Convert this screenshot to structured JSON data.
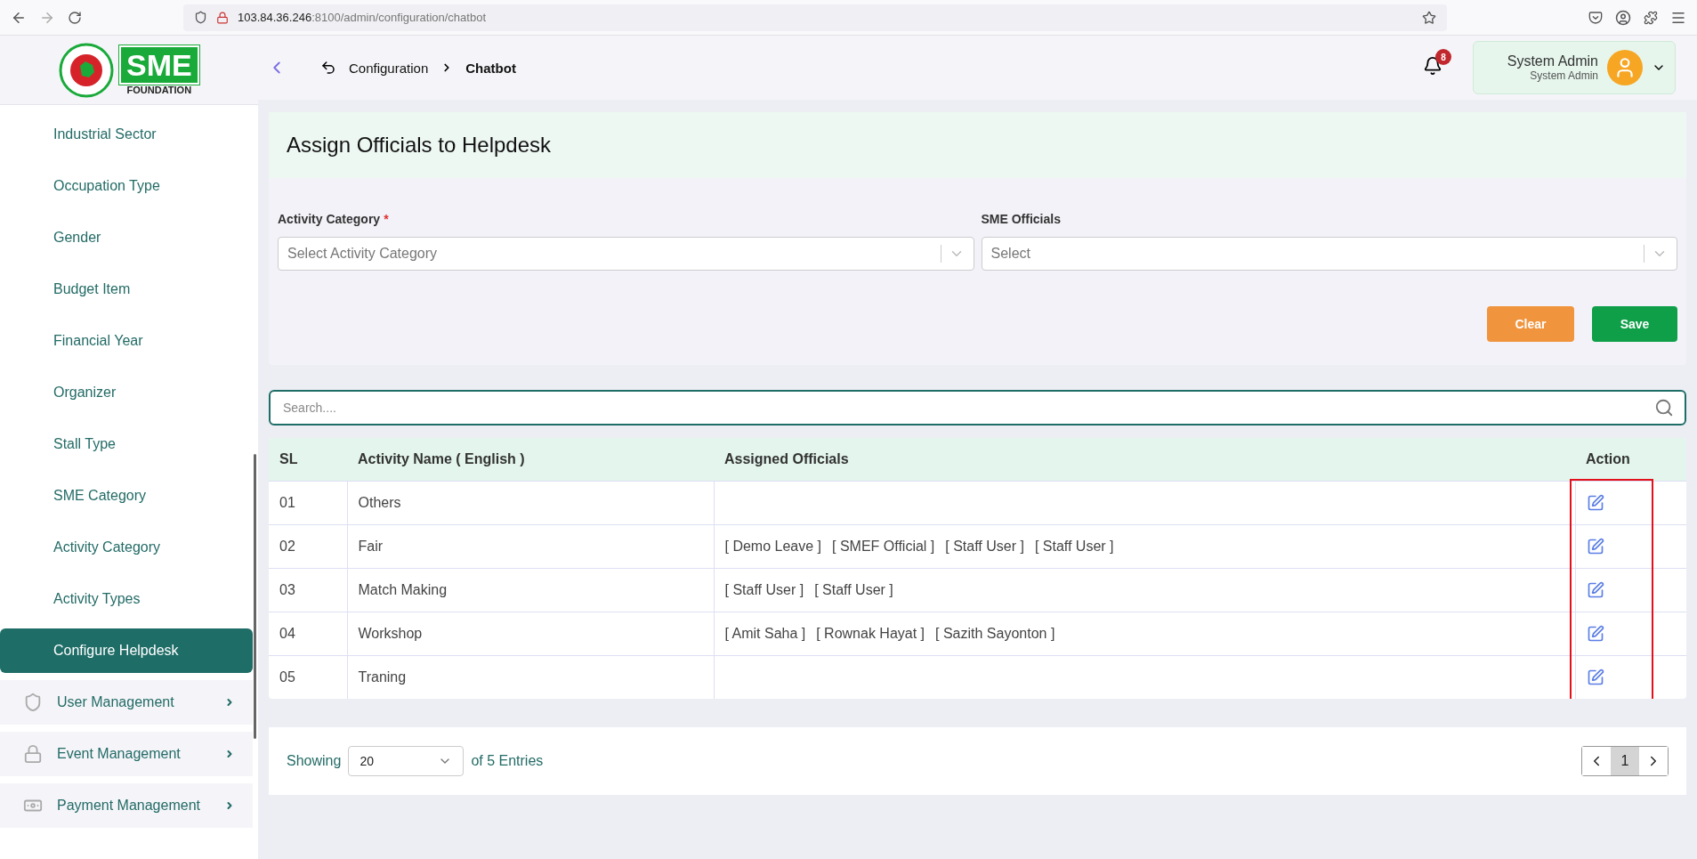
{
  "browser": {
    "host": "103.84.36.246",
    "path": ":8100/admin/configuration/chatbot"
  },
  "logo": {
    "word": "SME",
    "tagline": "FOUNDATION"
  },
  "header": {
    "breadcrumb": [
      "Configuration",
      "Chatbot"
    ],
    "notifications": "8",
    "user": {
      "name": "System Admin",
      "role": "System Admin"
    }
  },
  "sidebar": {
    "items": [
      {
        "kind": "link",
        "label": "Industrial Sector",
        "selected": false
      },
      {
        "kind": "link",
        "label": "Occupation Type",
        "selected": false
      },
      {
        "kind": "link",
        "label": "Gender",
        "selected": false
      },
      {
        "kind": "link",
        "label": "Budget Item",
        "selected": false
      },
      {
        "kind": "link",
        "label": "Financial Year",
        "selected": false
      },
      {
        "kind": "link",
        "label": "Organizer",
        "selected": false
      },
      {
        "kind": "link",
        "label": "Stall Type",
        "selected": false
      },
      {
        "kind": "link",
        "label": "SME Category",
        "selected": false
      },
      {
        "kind": "link",
        "label": "Activity Category",
        "selected": false
      },
      {
        "kind": "link",
        "label": "Activity Types",
        "selected": false
      },
      {
        "kind": "link",
        "label": "Configure Helpdesk",
        "selected": true
      },
      {
        "kind": "group",
        "label": "User Management",
        "expanded": false
      },
      {
        "kind": "group",
        "label": "Event Management",
        "expanded": false
      },
      {
        "kind": "group",
        "label": "Payment Management",
        "expanded": false
      }
    ]
  },
  "form": {
    "title": "Assign Officials to Helpdesk",
    "fields": [
      {
        "label": "Activity Category",
        "required_mark": "*",
        "placeholder": "Select Activity Category"
      },
      {
        "label": "SME Officials",
        "placeholder": "Select"
      }
    ],
    "buttons": [
      {
        "kind": "warning",
        "label": "Clear"
      },
      {
        "kind": "primary",
        "label": "Save"
      }
    ]
  },
  "search": {
    "placeholder": "Search...."
  },
  "table": {
    "columns": [
      "SL",
      "Activity Name ( English )",
      "Assigned Officials",
      "Action"
    ],
    "rows": [
      {
        "sl": "01",
        "name": "Others",
        "officials": []
      },
      {
        "sl": "02",
        "name": "Fair",
        "officials": [
          "[ Demo Leave ]",
          "[ SMEF Official ]",
          "[ Staff User ]",
          "[ Staff User ]"
        ]
      },
      {
        "sl": "03",
        "name": "Match Making",
        "officials": [
          "[ Staff User ]",
          "[ Staff User ]"
        ]
      },
      {
        "sl": "04",
        "name": "Workshop",
        "officials": [
          "[ Amit Saha ]",
          "[ Rownak Hayat ]",
          "[ Sazith Sayonton ]"
        ]
      },
      {
        "sl": "05",
        "name": "Traning",
        "officials": []
      }
    ],
    "action_column_highlighted": true
  },
  "pagination": {
    "showing": "Showing",
    "page_size": "20",
    "entries": "of 5 Entries",
    "pages": [
      {
        "label": "1",
        "selected": true
      }
    ]
  }
}
